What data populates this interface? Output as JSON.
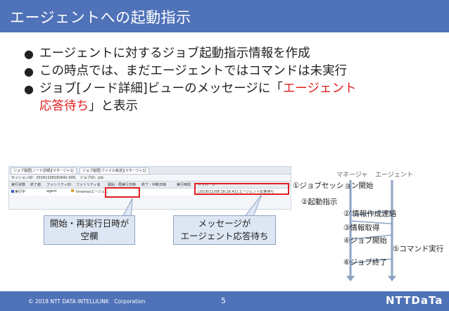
{
  "title": "エージェントへの起動指示",
  "bullets": [
    {
      "text": "エージェントに対するジョブ起動指示情報を作成"
    },
    {
      "text": "この時点では、まだエージェントではコマンドは未実行"
    },
    {
      "pre": "ジョブ[ノード詳細]ビューのメッセージに「",
      "highlight1": "エージェント",
      "highlight2": "応答待ち",
      "post": "」と表示"
    }
  ],
  "screenshot": {
    "tab1": "ジョブ履歴[ノード詳細][マネージャ1]",
    "tab2": "ジョブ履歴[ファイル転送][マネージャ1]",
    "session": "セッションID：20161108182642-000,　ジョブID：job",
    "headers": [
      "実行状態",
      "終了値",
      "ファシリティID",
      "ファシリティ名",
      "開始・再実行日時",
      "終了・中断日時",
      "実行時間",
      "メッセージ"
    ],
    "row": {
      "status": "実行中",
      "facility_id": "agent",
      "facility_name": "hinemosエージェ...",
      "message": "[2016/11/08 18:26:42] エージェント応答待ち"
    }
  },
  "callouts": {
    "left": [
      "開始・再実行日時が",
      "空欄"
    ],
    "right": [
      "メッセージが",
      "エージェント応答待ち"
    ]
  },
  "sequence": {
    "manager_label": "マネージャ",
    "agent_label": "エージェント",
    "steps": [
      "①ジョブセッション開始",
      "②起動指示",
      "②'情報作成連絡",
      "③情報取得",
      "④ジョブ開始",
      "⑤コマンド実行",
      "⑥ジョブ終了"
    ]
  },
  "footer": {
    "copyright": "© 2018 NTT DATA INTELLILINK　Corporation",
    "page": "5",
    "logo": "NTTDaTa"
  },
  "colors": {
    "accent": "#4f72b8",
    "highlight": "#e02020",
    "callout": "#dde6f3",
    "arrow": "#8ea3c4"
  }
}
